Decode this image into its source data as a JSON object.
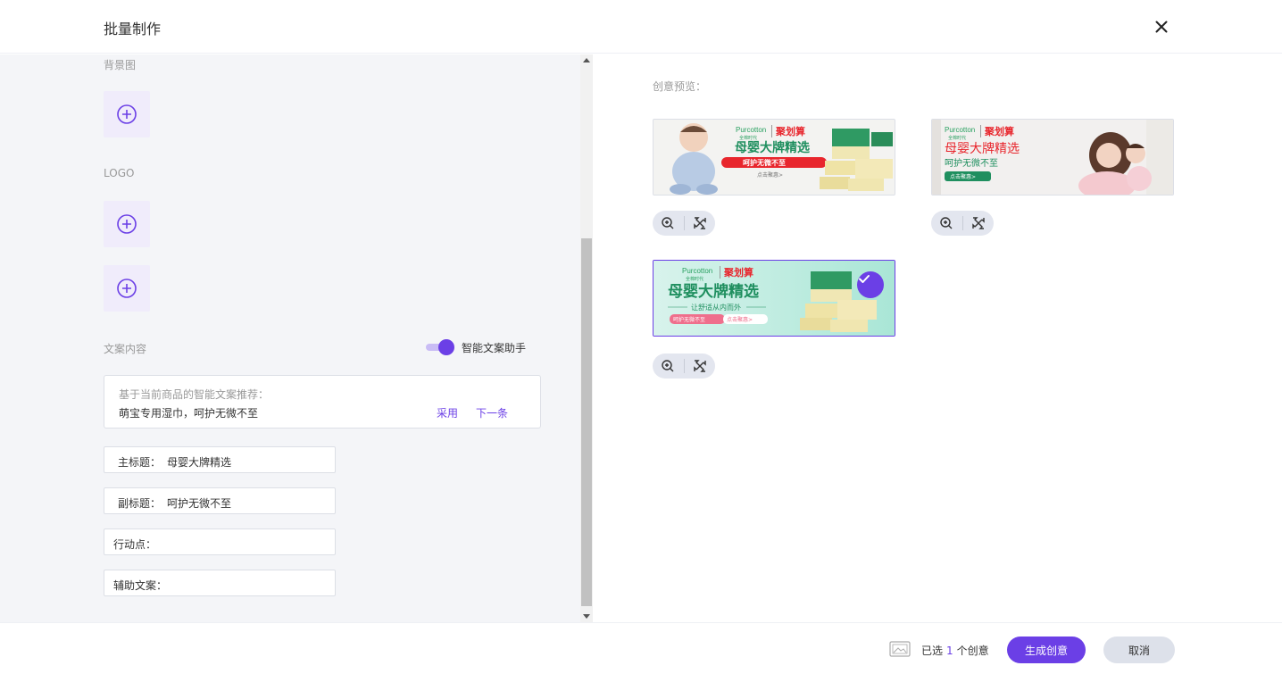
{
  "header": {
    "title": "批量制作",
    "close_icon": "close-icon"
  },
  "left": {
    "background_label": "背景图",
    "logo_label": "LOGO",
    "copy_label": "文案内容",
    "assistant_toggle_label": "智能文案助手",
    "assistant_enabled": true,
    "suggestion": {
      "hint": "基于当前商品的智能文案推荐：",
      "text": "萌宝专用湿巾，呵护无微不至",
      "adopt_label": "采用",
      "next_label": "下一条"
    },
    "fields": {
      "main_title": {
        "label": "主标题：",
        "value": "母婴大牌精选"
      },
      "sub_title": {
        "label": "副标题：",
        "value": "呵护无微不至"
      },
      "action": {
        "label": "行动点：",
        "value": ""
      },
      "aux_copy": {
        "label": "辅助文案：",
        "value": ""
      }
    }
  },
  "right": {
    "preview_label": "创意预览：",
    "cards": [
      {
        "brand": "Purcotton",
        "brand_cn": "全棉时代",
        "platform": "聚划算",
        "headline": "母婴大牌精选",
        "subline": "呵护无微不至",
        "cta": "点击聚惠>",
        "selected": false
      },
      {
        "brand": "Purcotton",
        "brand_cn": "全棉时代",
        "platform": "聚划算",
        "headline": "母婴大牌精选",
        "subline": "呵护无微不至",
        "cta": "点击聚惠>",
        "selected": false
      },
      {
        "brand": "Purcotton",
        "brand_cn": "全棉时代",
        "platform": "聚划算",
        "headline": "母婴大牌精选",
        "subline": "让舒适从内而外",
        "tag": "呵护无微不至",
        "cta": "点击聚惠>",
        "selected": true
      }
    ]
  },
  "footer": {
    "selected_prefix": "已选",
    "selected_count": "1",
    "selected_suffix": "个创意",
    "generate_label": "生成创意",
    "cancel_label": "取消"
  },
  "colors": {
    "accent": "#6b3fe6",
    "panel_bg": "#f4f5f8",
    "danger_red": "#e8262d",
    "ad_green": "#1f8f5f"
  }
}
